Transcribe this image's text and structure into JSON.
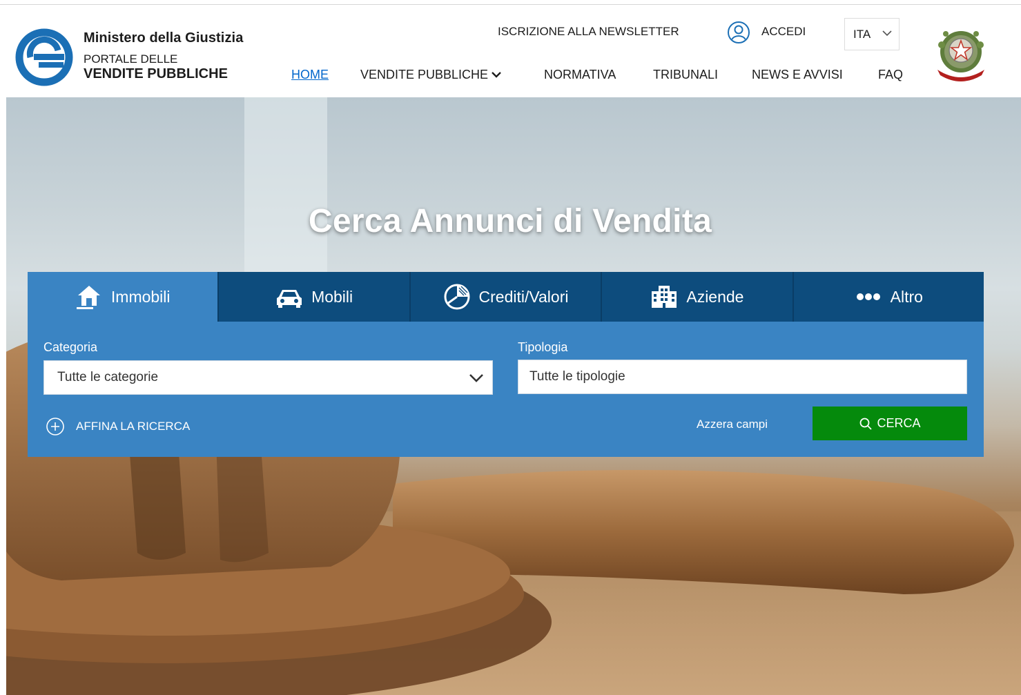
{
  "brand": {
    "ministry": "Ministero della Giustizia",
    "portal_line1": "PORTALE DELLE",
    "portal_line2": "VENDITE PUBBLICHE",
    "primary_color": "#1b6fb5"
  },
  "header": {
    "newsletter_label": "ISCRIZIONE ALLA NEWSLETTER",
    "login_label": "ACCEDI",
    "language": "ITA"
  },
  "nav": {
    "home": "HOME",
    "vendite": "VENDITE PUBBLICHE",
    "normativa": "NORMATIVA",
    "tribunali": "TRIBUNALI",
    "news": "NEWS E AVVISI",
    "faq": "FAQ"
  },
  "hero": {
    "title": "Cerca Annunci di Vendita"
  },
  "search": {
    "tabs": [
      {
        "label": "Immobili",
        "icon": "house-icon",
        "active": true
      },
      {
        "label": "Mobili",
        "icon": "car-icon",
        "active": false
      },
      {
        "label": "Crediti/Valori",
        "icon": "pie-chart-icon",
        "active": false
      },
      {
        "label": "Aziende",
        "icon": "building-icon",
        "active": false
      },
      {
        "label": "Altro",
        "icon": "ellipsis-icon",
        "active": false
      }
    ],
    "category_label": "Categoria",
    "category_value": "Tutte le categorie",
    "type_label": "Tipologia",
    "type_placeholder": "Tutte le tipologie",
    "refine_label": "AFFINA LA RICERCA",
    "reset_label": "Azzera campi",
    "submit_label": "CERCA",
    "panel_color": "#3a84c3",
    "tab_color": "#0d4c7d",
    "submit_color": "#058a0c"
  }
}
